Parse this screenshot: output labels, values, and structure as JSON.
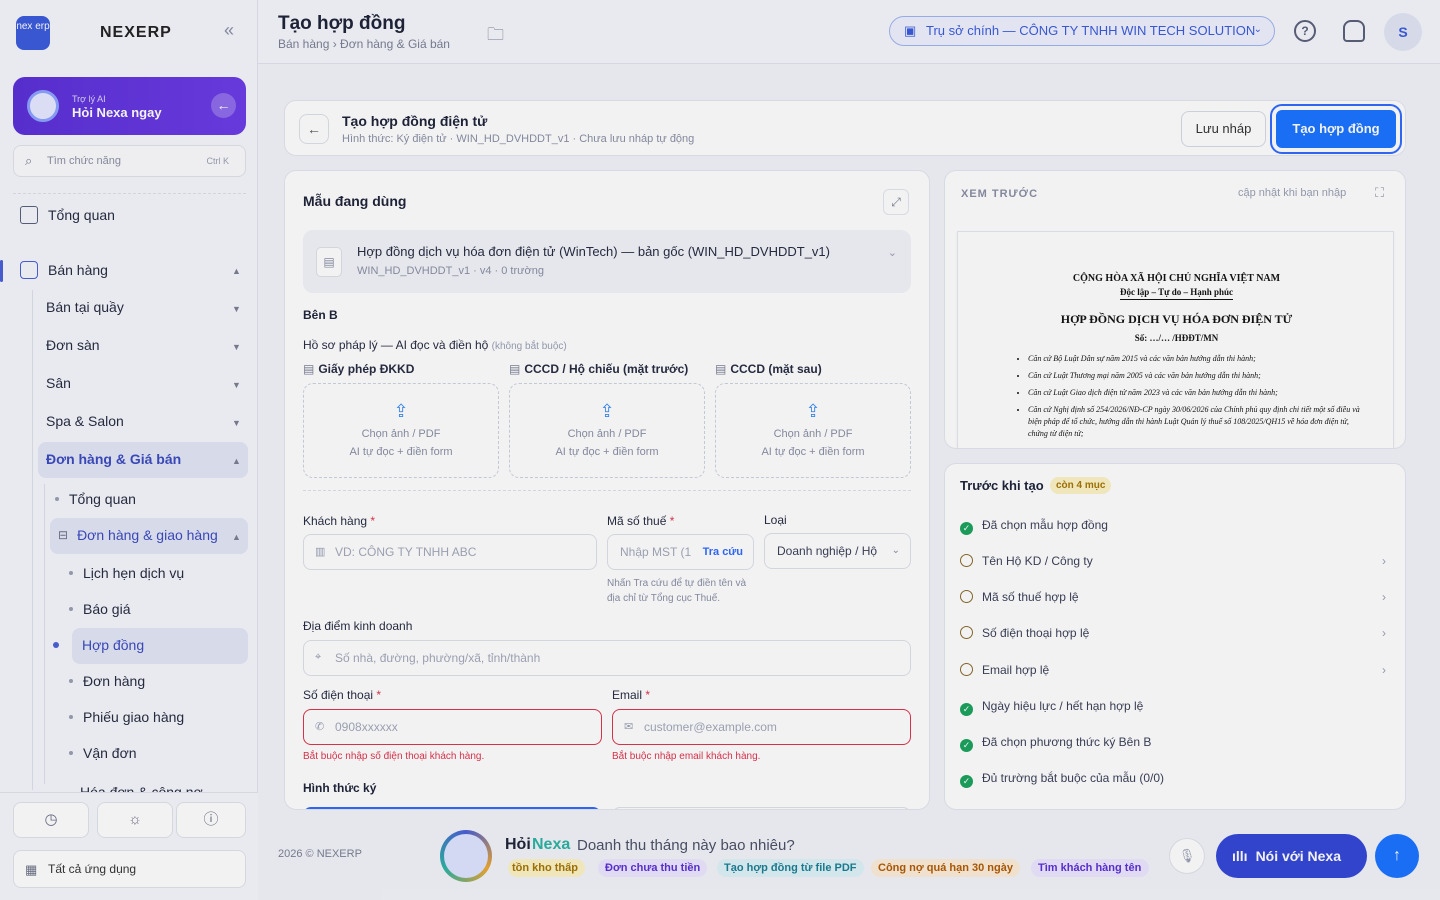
{
  "app": {
    "logo_text": "nex erp",
    "brand": "NEXERP"
  },
  "ai_card": {
    "small": "Trợ lý AI",
    "main": "Hỏi Nexa ngay"
  },
  "side_search": {
    "placeholder": "Tìm chức năng",
    "shortcut": "Ctrl K"
  },
  "sidebar": {
    "overview": "Tổng quan",
    "sales": "Bán hàng",
    "groups": [
      "Bán tại quầy",
      "Đơn sàn",
      "Sân",
      "Spa & Salon",
      "Đơn hàng & Giá bán"
    ],
    "sub": [
      "Tổng quan",
      "Đơn hàng & giao hàng"
    ],
    "leaves": [
      "Lịch hẹn dịch vụ",
      "Báo giá",
      "Hợp đồng",
      "Đơn hàng",
      "Phiếu giao hàng",
      "Vận đơn"
    ],
    "cut_item": "Hóa đơn & công nợ",
    "all_apps": "Tất cả ứng dụng"
  },
  "topbar": {
    "title": "Tạo hợp đồng",
    "breadcrumb": "Bán hàng › Đơn hàng & Giá bán",
    "org": "Trụ sở chính — CÔNG TY TNHH WIN TECH SOLUTION",
    "avatar": "S"
  },
  "header_card": {
    "title": "Tạo hợp đồng điện tử",
    "subtitle": "Hình thức: Ký điện tử · WIN_HD_DVHDDT_v1 · Chưa lưu nháp tự động",
    "draft_button": "Lưu nháp",
    "create_button": "Tạo hợp đồng"
  },
  "form": {
    "template_section": "Mẫu đang dùng",
    "template_name": "Hợp đồng dịch vụ hóa đơn điện tử (WinTech) — bản gốc (WIN_HD_DVHDDT_v1)",
    "template_meta": "WIN_HD_DVHDDT_v1 · v4 · 0 trường",
    "party_b": "Bên B",
    "legal_title": "Hồ sơ pháp lý — AI đọc và điền hộ",
    "legal_optional": "(không bắt buộc)",
    "uploads": [
      {
        "label": "Giấy phép ĐKKD",
        "line1": "Chọn ảnh / PDF",
        "line2": "AI tự đọc + điền form"
      },
      {
        "label": "CCCD / Hộ chiếu (mặt trước)",
        "line1": "Chọn ảnh / PDF",
        "line2": "AI tự đọc + điền form"
      },
      {
        "label": "CCCD (mặt sau)",
        "line1": "Chọn ảnh / PDF",
        "line2": "AI tự đọc + điền form"
      }
    ],
    "customer_label": "Khách hàng",
    "customer_placeholder": "VD: CÔNG TY TNHH ABC",
    "tax_label": "Mã số thuế",
    "tax_placeholder": "Nhập MST (1",
    "tax_lookup": "Tra cứu",
    "tax_hint": "Nhấn Tra cứu để tự điền tên và địa chỉ từ Tổng cục Thuế.",
    "type_label": "Loại",
    "type_value": "Doanh nghiệp / Hộ",
    "address_label": "Địa điểm kinh doanh",
    "address_placeholder": "Số nhà, đường, phường/xã, tỉnh/thành",
    "phone_label": "Số điện thoại",
    "phone_placeholder": "0908xxxxxx",
    "phone_error": "Bắt buộc nhập số điện thoại khách hàng.",
    "email_label": "Email",
    "email_placeholder": "customer@example.com",
    "email_error": "Bắt buộc nhập email khách hàng.",
    "sign_method": "Hình thức ký",
    "required_mark": "*"
  },
  "preview": {
    "heading": "XEM TRƯỚC",
    "note": "cập nhật khi bạn nhập",
    "doc": {
      "line1": "CỘNG HÒA XÃ HỘI CHỦ NGHĨA VIỆT NAM",
      "line2": "Độc lập – Tự do – Hạnh phúc",
      "title": "HỢP ĐỒNG DỊCH VỤ HÓA ĐƠN ĐIỆN TỬ",
      "number": "Số: …/… /HĐĐT/MN",
      "bases": [
        "Căn cứ Bộ Luật Dân sự năm 2015 và các văn bản hướng dẫn thi hành;",
        "Căn cứ Luật Thương mại năm 2005 và các văn bản hướng dẫn thi hành;",
        "Căn cứ Luật Giao dịch điện tử năm 2023 và các văn bản hướng dẫn thi hành;",
        "Căn cứ Nghị định số 254/2026/NĐ-CP ngày 30/06/2026 của Chính phủ quy định chi tiết một số điều và biện pháp để tổ chức, hướng dẫn thi hành Luật Quản lý thuế số 108/2025/QH15 về hóa đơn điện tử, chứng từ điện tử;"
      ]
    }
  },
  "checklist": {
    "title": "Trước khi tạo",
    "badge": "còn 4 mục",
    "items": [
      {
        "label": "Đã chọn mẫu hợp đồng",
        "done": true
      },
      {
        "label": "Tên Hộ KD / Công ty",
        "done": false
      },
      {
        "label": "Mã số thuế hợp lệ",
        "done": false
      },
      {
        "label": "Số điện thoại hợp lệ",
        "done": false
      },
      {
        "label": "Email hợp lệ",
        "done": false
      },
      {
        "label": "Ngày hiệu lực / hết hạn hợp lệ",
        "done": true
      },
      {
        "label": "Đã chọn phương thức ký Bên B",
        "done": true
      },
      {
        "label": "Đủ trường bắt buộc của mẫu (0/0)",
        "done": true
      }
    ]
  },
  "footer": "2026 © NEXERP",
  "assistant": {
    "hoi": "Hỏi",
    "nexa": "Nexa",
    "question": "Doanh thu tháng này bao nhiêu?",
    "chips": [
      "tồn kho thấp",
      "Đơn chưa thu tiền",
      "Tạo hợp đồng từ file PDF",
      "Công nợ quá hạn 30 ngày",
      "Tìm khách hàng tên"
    ],
    "talk": "Nói với Nexa"
  }
}
